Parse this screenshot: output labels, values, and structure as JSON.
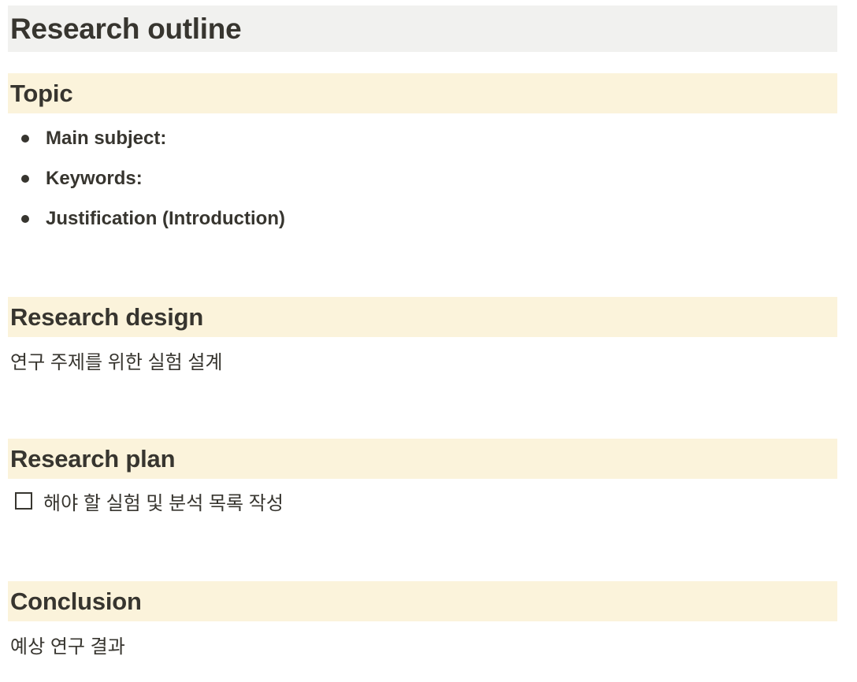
{
  "document": {
    "title": "Research outline"
  },
  "sections": {
    "topic": {
      "heading": "Topic",
      "bullets": [
        "Main subject:",
        "Keywords:",
        "Justification (Introduction)"
      ]
    },
    "design": {
      "heading": "Research design",
      "text": "연구 주제를 위한 실험 설계"
    },
    "plan": {
      "heading": "Research plan",
      "todo": {
        "text": "해야 할 실험 및 분석 목록 작성",
        "checked": false
      }
    },
    "conclusion": {
      "heading": "Conclusion",
      "text": "예상 연구 결과"
    }
  },
  "colors": {
    "title_background": "#f1f1ef",
    "heading_background": "#fbf3db",
    "text": "#37352f"
  }
}
